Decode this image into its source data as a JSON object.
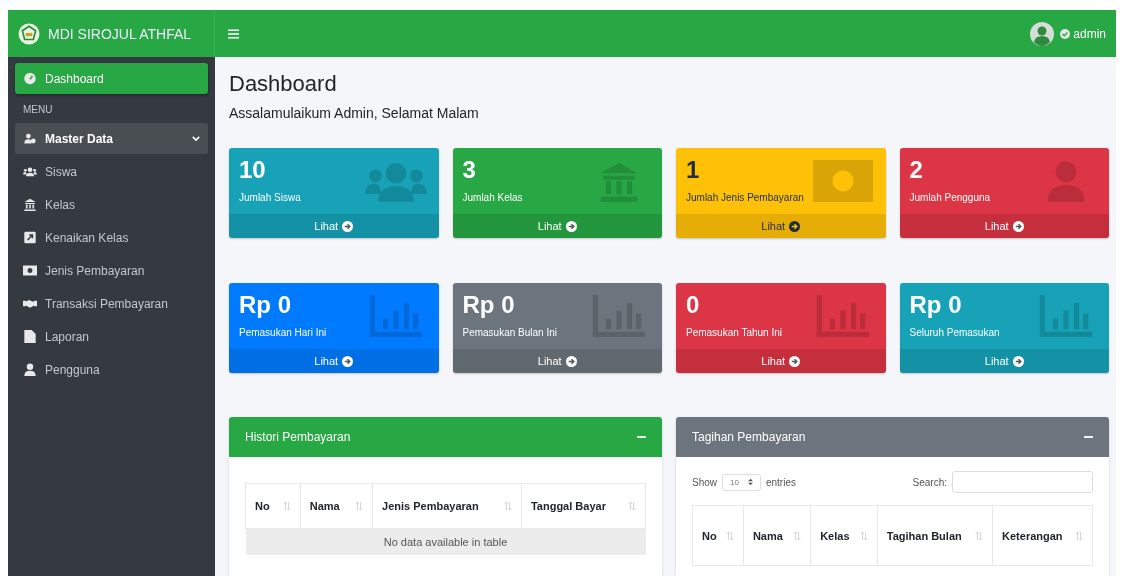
{
  "brand": {
    "title": "MDI SIROJUL ATHFAL"
  },
  "user": {
    "name": "admin"
  },
  "sidebar": {
    "items": [
      {
        "label": "Dashboard",
        "kind": "dashboard",
        "selected": true
      }
    ],
    "section": "MENU",
    "menu": [
      {
        "label": "Master Data",
        "kind": "folder",
        "selected": false,
        "expanded": true,
        "children": [
          {
            "label": "Siswa",
            "kind": "students",
            "selected": false
          },
          {
            "label": "Kelas",
            "kind": "classes",
            "selected": false
          },
          {
            "label": "Kenaikan Kelas",
            "kind": "promote",
            "selected": false
          },
          {
            "label": "Jenis Pembayaran",
            "kind": "money",
            "selected": false
          },
          {
            "label": "Transaksi Pembayaran",
            "kind": "handshake",
            "selected": false
          }
        ]
      },
      {
        "label": "Laporan",
        "kind": "report",
        "selected": false
      },
      {
        "label": "Pengguna",
        "kind": "user",
        "selected": false
      }
    ]
  },
  "page": {
    "title": "Dashboard",
    "greeting": "Assalamulaikum Admin, Selamat Malam"
  },
  "stat_cards": [
    {
      "value": "10",
      "label": "Jumlah Siswa",
      "link": "Lihat",
      "color": "#17a2b8",
      "kind": "students"
    },
    {
      "value": "3",
      "label": "Jumlah Kelas",
      "link": "Lihat",
      "color": "#28a745",
      "kind": "classes"
    },
    {
      "value": "1",
      "label": "Jumlah Jenis Pembayaran",
      "link": "Lihat",
      "color": "#ffc107",
      "kind": "money"
    },
    {
      "value": "2",
      "label": "Jumlah Pengguna",
      "link": "Lihat",
      "color": "#dc3545",
      "kind": "user"
    },
    {
      "value": "Rp 0",
      "label": "Pemasukan Hari Ini",
      "link": "Lihat",
      "color": "#007bff",
      "kind": "chart"
    },
    {
      "value": "Rp 0",
      "label": "Pemasukan Bulan Ini",
      "link": "Lihat",
      "color": "#6c757d",
      "kind": "chart"
    },
    {
      "value": "0",
      "label": "Pemasukan Tahun Ini",
      "link": "Lihat",
      "color": "#dc3545",
      "kind": "chart"
    },
    {
      "value": "Rp 0",
      "label": "Seluruh Pemasukan",
      "link": "Lihat",
      "color": "#17a2b8",
      "kind": "chart"
    }
  ],
  "panels": [
    {
      "title": "Histori Pembayaran",
      "color": "#28a745",
      "columns": [
        "No",
        "Nama",
        "Jenis Pembayaran",
        "Tanggal Bayar"
      ],
      "empty_text": "No data available in table"
    },
    {
      "title": "Tagihan Pembayaran",
      "color": "#6c757d",
      "show_label": "Show",
      "page_size": "10",
      "entries_label": "entries",
      "search_label": "Search:",
      "columns": [
        "No",
        "Nama",
        "Kelas",
        "Tagihan Bulan",
        "Keterangan"
      ]
    }
  ]
}
